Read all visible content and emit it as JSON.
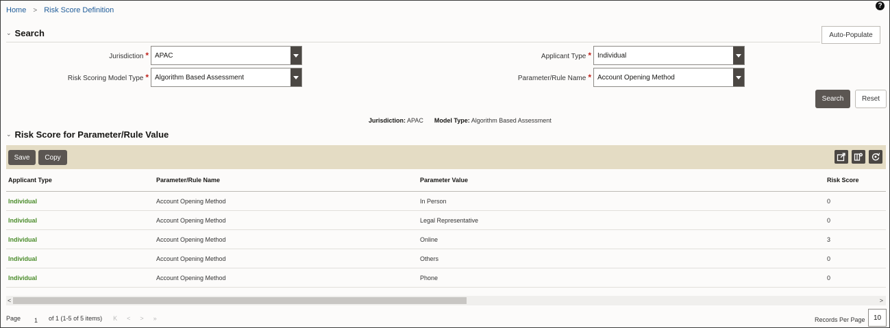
{
  "breadcrumb": {
    "home": "Home",
    "separator": ">",
    "current": "Risk Score Definition"
  },
  "help_icon": "?",
  "search": {
    "title": "Search",
    "chevron": "⌄",
    "auto_populate_label": "Auto-Populate",
    "fields": {
      "jurisdiction": {
        "label": "Jurisdiction",
        "value": "APAC"
      },
      "applicant_type": {
        "label": "Applicant Type",
        "value": "Individual"
      },
      "model_type": {
        "label": "Risk Scoring Model Type",
        "value": "Algorithm Based Assessment"
      },
      "parameter": {
        "label": "Parameter/Rule Name",
        "value": "Account Opening Method"
      }
    },
    "required_mark": "*",
    "search_label": "Search",
    "reset_label": "Reset"
  },
  "summary": {
    "jurisdiction_label": "Jurisdiction:",
    "jurisdiction_value": "APAC",
    "model_label": "Model Type:",
    "model_value": "Algorithm Based Assessment"
  },
  "results": {
    "title": "Risk Score for Parameter/Rule Value",
    "chevron": "⌄",
    "save_label": "Save",
    "copy_label": "Copy",
    "toolbar_icons": [
      "export-icon",
      "column-settings-icon",
      "refresh-icon"
    ],
    "columns": [
      "Applicant Type",
      "Parameter/Rule Name",
      "Parameter Value",
      "Risk Score"
    ],
    "rows": [
      {
        "applicant_type": "Individual",
        "parameter": "Account Opening Method",
        "value": "In Person",
        "score": "0"
      },
      {
        "applicant_type": "Individual",
        "parameter": "Account Opening Method",
        "value": "Legal Representative",
        "score": "0"
      },
      {
        "applicant_type": "Individual",
        "parameter": "Account Opening Method",
        "value": "Online",
        "score": "3"
      },
      {
        "applicant_type": "Individual",
        "parameter": "Account Opening Method",
        "value": "Others",
        "score": "0"
      },
      {
        "applicant_type": "Individual",
        "parameter": "Account Opening Method",
        "value": "Phone",
        "score": "0"
      }
    ]
  },
  "scrollbar": {
    "left": "<",
    "right": ">"
  },
  "pagination": {
    "page_label": "Page",
    "page_number": "1",
    "of_text": "of 1 (1-5 of 5 items)",
    "first": "K",
    "prev": "<",
    "next": ">",
    "last": "»",
    "records_per_page_label": "Records Per Page",
    "records_per_page": "10"
  },
  "colors": {
    "accent_link": "#1f5c99",
    "applicant_link": "#4a8c2a",
    "toolbar_bg": "#e4dcc4",
    "button_dark": "#5b5652",
    "required": "#c0221b"
  }
}
